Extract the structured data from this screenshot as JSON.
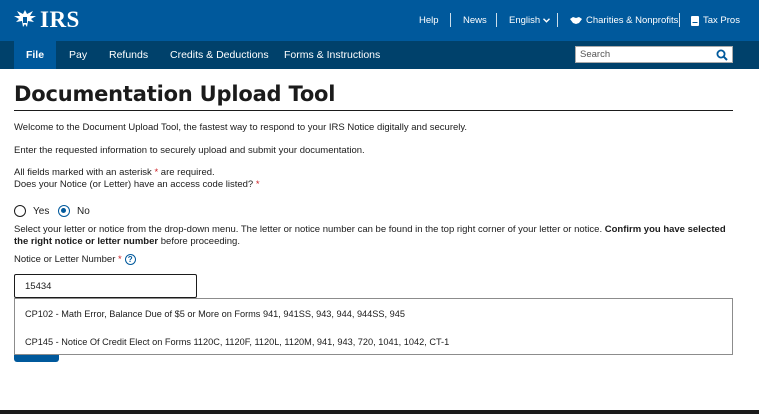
{
  "header": {
    "logo_text": "IRS",
    "utility_links": {
      "help": "Help",
      "news": "News",
      "language": "English",
      "charities": "Charities & Nonprofits",
      "tax_pros": "Tax Pros"
    }
  },
  "nav": {
    "items": [
      "File",
      "Pay",
      "Refunds",
      "Credits & Deductions",
      "Forms & Instructions"
    ],
    "active": "File",
    "search_placeholder": "Search"
  },
  "page": {
    "title": "Documentation Upload Tool",
    "welcome": "Welcome to the Document Upload Tool, the fastest way to respond to your IRS Notice digitally and securely.",
    "enter_info": "Enter the requested information to securely upload and submit your documentation.",
    "required_prefix": "All fields marked with an asterisk ",
    "required_suffix": " are required.",
    "access_code_question": "Does your Notice (or Letter) have an access code listed?",
    "asterisk": "*",
    "radio_yes": "Yes",
    "radio_no": "No",
    "radio_selected": "No",
    "instructions_plain": "Select your letter or notice from the drop-down menu. The letter or notice number can be found in the top right corner of your letter or notice. ",
    "instructions_bold": "Confirm you have selected the right notice or letter number",
    "instructions_end": " before proceeding.",
    "notice_label": "Notice or Letter Number",
    "notice_value": "15434",
    "dropdown_options": [
      "CP102 - Math Error, Balance Due of $5 or More on Forms 941, 941SS, 943, 944, 944SS, 945",
      "CP145 - Notice Of Credit Elect on Forms 1120C, 1120F, 1120L, 1120M, 941, 943, 720, 1041, 1042, CT-1"
    ]
  },
  "colors": {
    "topbar": "#00599c",
    "navbar": "#00416b",
    "required": "#cd2026",
    "accent": "#00599c"
  },
  "icons": [
    "irs-eagle-logo",
    "chevron-down-icon",
    "handshake-icon",
    "id-card-icon",
    "search-icon",
    "help-circle-icon"
  ]
}
